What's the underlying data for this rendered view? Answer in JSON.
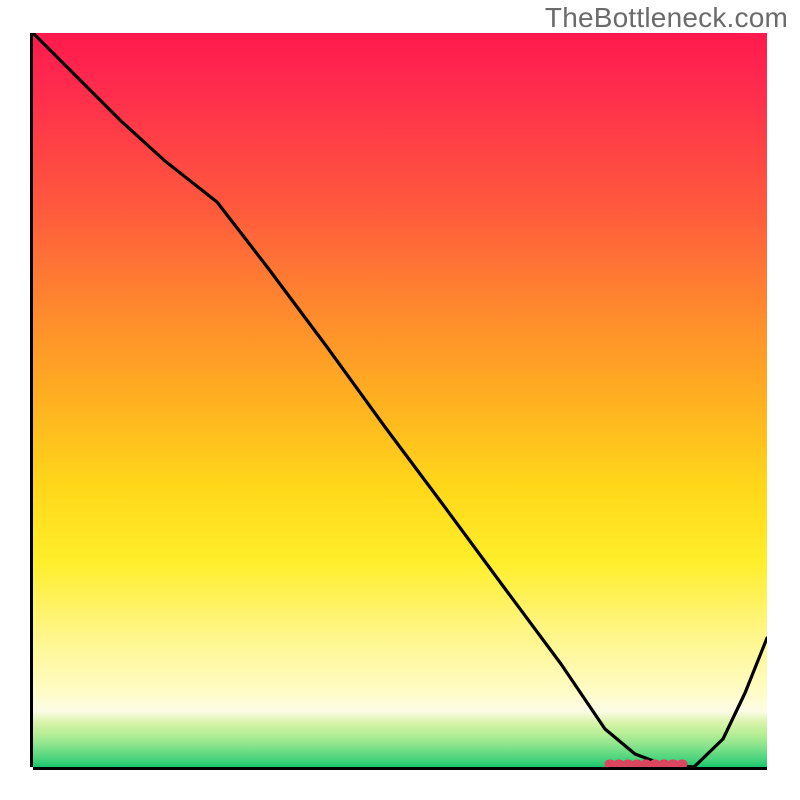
{
  "domain": "Chart",
  "watermark": "TheBottleneck.com",
  "chart_data": {
    "type": "line",
    "title": "",
    "xlabel": "",
    "ylabel": "",
    "xlim": [
      0,
      1
    ],
    "ylim": [
      0,
      1
    ],
    "grid": false,
    "legend": false,
    "x": [
      0.0,
      0.06,
      0.12,
      0.18,
      0.25,
      0.32,
      0.4,
      0.48,
      0.56,
      0.64,
      0.72,
      0.78,
      0.82,
      0.86,
      0.9,
      0.94,
      0.97,
      1.0
    ],
    "values": [
      1.0,
      0.94,
      0.88,
      0.825,
      0.77,
      0.68,
      0.572,
      0.463,
      0.355,
      0.246,
      0.14,
      0.052,
      0.017,
      0.002,
      0.0,
      0.038,
      0.1,
      0.175
    ],
    "optimal_band_x": [
      0.785,
      0.885
    ],
    "curve_color": "#000000",
    "optimal_marker_color": "#d9465d",
    "background_gradient_stops": [
      {
        "pos": 0.0,
        "color": "#ff1a4d"
      },
      {
        "pos": 0.5,
        "color": "#ffb020"
      },
      {
        "pos": 0.85,
        "color": "#fffcc8"
      },
      {
        "pos": 1.0,
        "color": "#18c56d"
      }
    ]
  }
}
